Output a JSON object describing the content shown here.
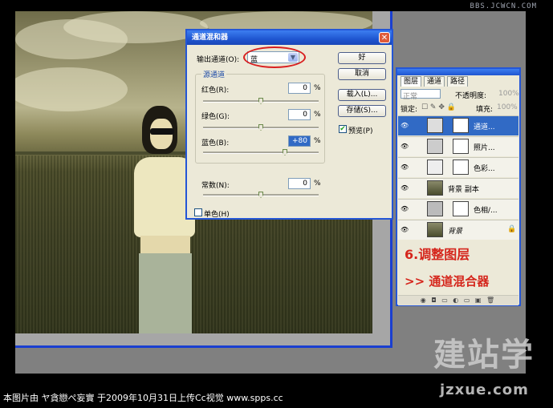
{
  "watermark_top": "BBS.JCWCN.COM",
  "dialog": {
    "title": "通道混和器",
    "close_glyph": "✕",
    "output_channel_label": "输出通道(O):",
    "output_channel_value": "蓝",
    "source_group_label": "源通道",
    "channels": [
      {
        "label": "红色(R):",
        "value": "0",
        "unit": "%"
      },
      {
        "label": "绿色(G):",
        "value": "0",
        "unit": "%"
      },
      {
        "label": "蓝色(B):",
        "value": "+80",
        "unit": "%"
      }
    ],
    "constant_label": "常数(N):",
    "constant_value": "0",
    "constant_unit": "%",
    "monochrome_label": "单色(H)",
    "buttons": {
      "ok": "好",
      "cancel": "取消",
      "load": "载入(L)...",
      "save": "存储(S)..."
    },
    "preview_label": "预览(P)",
    "preview_checked": true,
    "monochrome_checked": false
  },
  "layers_panel": {
    "tabs": [
      "图层",
      "通道",
      "路径"
    ],
    "blend_mode": "正常",
    "opacity_label": "不透明度:",
    "opacity_value": "100%",
    "lock_label": "锁定:",
    "fill_label": "填充:",
    "fill_value": "100%",
    "layers": [
      {
        "name": "通道...",
        "selected": true
      },
      {
        "name": "照片..."
      },
      {
        "name": "色彩..."
      },
      {
        "name": "背景 副本"
      },
      {
        "name": "色相/..."
      },
      {
        "name": "背景"
      }
    ],
    "annotation_step": "6.调整图层",
    "annotation_action": ">>  通道混合器",
    "bottom_icons": "◉ ◘ ▭ ◐ ▭ ▣ 🗑"
  },
  "caption": "本图片由 ヤ貪戀ぺ妄實 于2009年10月31日上传Cc视觉 www.spps.cc",
  "watermark_logo": "建站学",
  "watermark_url": "jzxue.com"
}
